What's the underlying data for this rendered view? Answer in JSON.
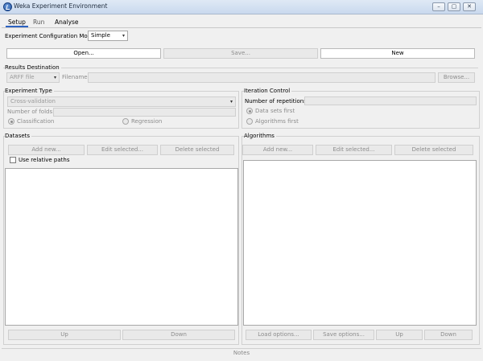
{
  "window": {
    "title": "Weka Experiment Environment",
    "controls": [
      "minimize",
      "maximize",
      "close"
    ]
  },
  "tabs": [
    {
      "label": "Setup",
      "active": true
    },
    {
      "label": "Run",
      "active": false
    },
    {
      "label": "Analyse",
      "active": false
    }
  ],
  "config_mode": {
    "label": "Experiment Configuration Mode",
    "value": "Simple"
  },
  "file_buttons": {
    "open": "Open...",
    "save": "Save...",
    "new": "New"
  },
  "results_destination": {
    "title": "Results Destination",
    "format": "ARFF file",
    "filename_label": "Filename:",
    "filename_value": "",
    "browse": "Browse..."
  },
  "experiment_type": {
    "title": "Experiment Type",
    "method": "Cross-validation",
    "folds_label": "Number of folds:",
    "folds_value": "",
    "classification": "Classification",
    "regression": "Regression"
  },
  "iteration_control": {
    "title": "Iteration Control",
    "repetitions_label": "Number of repetitions:",
    "repetitions_value": "",
    "data_sets_first": "Data sets first",
    "algorithms_first": "Algorithms first"
  },
  "datasets": {
    "title": "Datasets",
    "add_new": "Add new...",
    "edit_selected": "Edit selected...",
    "delete_selected": "Delete selected",
    "use_relative_paths": "Use relative paths",
    "up": "Up",
    "down": "Down"
  },
  "algorithms": {
    "title": "Algorithms",
    "add_new": "Add new...",
    "edit_selected": "Edit selected...",
    "delete_selected": "Delete selected",
    "load_options": "Load options...",
    "save_options": "Save options...",
    "up": "Up",
    "down": "Down"
  },
  "notes": "Notes",
  "icons": {
    "app": "weka-app-icon",
    "minimize": "minimize-icon",
    "maximize": "maximize-icon",
    "close": "close-icon",
    "dropdown": "chevron-down-icon"
  },
  "colors": {
    "titlebar": "#c9d9ee",
    "tab_underline": "#2c62c2",
    "window_bg": "#f0f0f0"
  }
}
